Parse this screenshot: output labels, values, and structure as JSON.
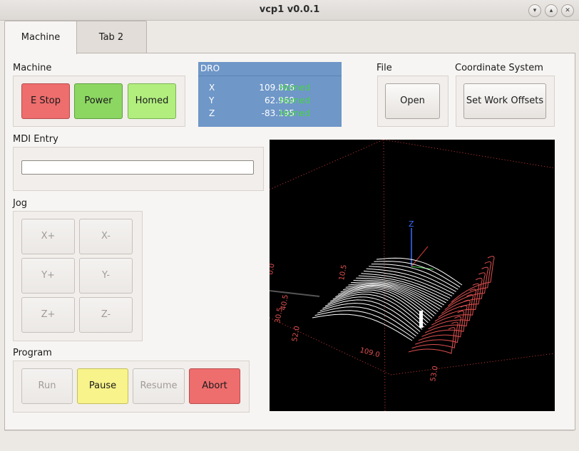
{
  "window": {
    "title": "vcp1 v0.0.1"
  },
  "tabs": [
    {
      "label": "Machine"
    },
    {
      "label": "Tab 2"
    }
  ],
  "machine": {
    "label": "Machine",
    "estop": "E Stop",
    "power": "Power",
    "homed": "Homed"
  },
  "dro": {
    "label": "DRO",
    "rows": [
      {
        "axis": "X",
        "value": "109.876",
        "status": "Homed"
      },
      {
        "axis": "Y",
        "value": "62.969",
        "status": "Homed"
      },
      {
        "axis": "Z",
        "value": "-83.195",
        "status": "Homed"
      }
    ]
  },
  "file": {
    "label": "File",
    "open": "Open"
  },
  "coords": {
    "label": "Coordinate System",
    "set_offsets": "Set Work Offsets"
  },
  "mdi": {
    "label": "MDI Entry",
    "value": "",
    "placeholder": ""
  },
  "jog": {
    "label": "Jog",
    "buttons": [
      "X+",
      "X-",
      "Y+",
      "Y-",
      "Z+",
      "Z-"
    ]
  },
  "program": {
    "label": "Program",
    "run": "Run",
    "pause": "Pause",
    "resume": "Resume",
    "abort": "Abort"
  },
  "preview": {
    "axis_label": "Z",
    "dims": [
      "109.0",
      "53.0",
      "52.0",
      "40.5",
      "30.5",
      "10.5",
      "0.0"
    ]
  },
  "colors": {
    "estop": "#ee6d6d",
    "power": "#8cd662",
    "homed": "#b1ee7e",
    "pause": "#f8f38a",
    "abort": "#ee6d6d",
    "dro_bg": "#6f97c8",
    "dro_homed": "#49d24a",
    "toolpath_rapid": "#e05050",
    "toolpath_feed": "#ffffff",
    "axis_z": "#3a6cff"
  }
}
